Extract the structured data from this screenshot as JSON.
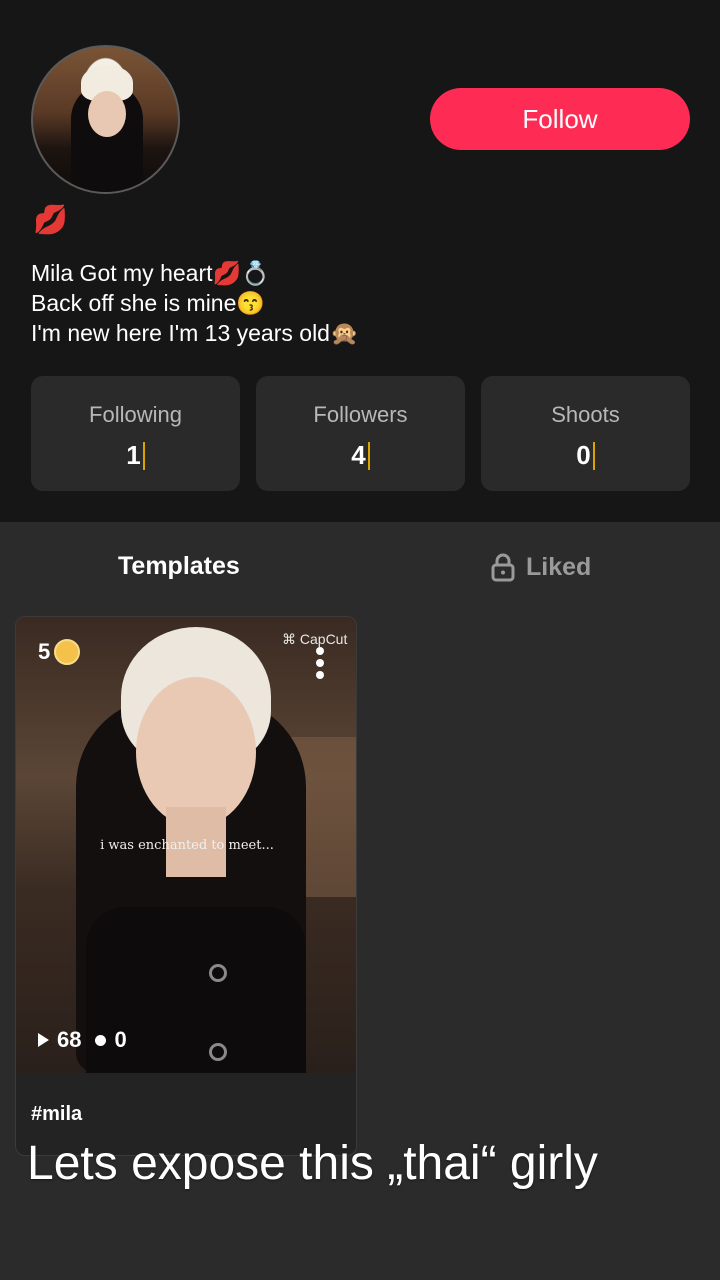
{
  "profile": {
    "follow_label": "Follow",
    "kiss_badge": "💋",
    "bio_lines": [
      "Mila Got my heart💋💍",
      "Back off she is mine😙",
      "I'm new here I'm 13 years old🙊"
    ]
  },
  "stats": [
    {
      "label": "Following",
      "value": "1"
    },
    {
      "label": "Followers",
      "value": "4"
    },
    {
      "label": "Shoots",
      "value": "0"
    }
  ],
  "tabs": {
    "templates": "Templates",
    "liked": "Liked"
  },
  "card": {
    "coins": "5",
    "brand": "CapCut",
    "caption": "i was enchanted to meet...",
    "plays": "68",
    "comments": "0",
    "tag": "#mila"
  },
  "overlay_text": "Lets expose this „thai“ girly",
  "colors": {
    "accent": "#fe2c55",
    "bg_top": "#161616",
    "bg_bottom": "#2b2b2b",
    "card_bg": "#2a2a2a",
    "caret": "#d9a300"
  }
}
